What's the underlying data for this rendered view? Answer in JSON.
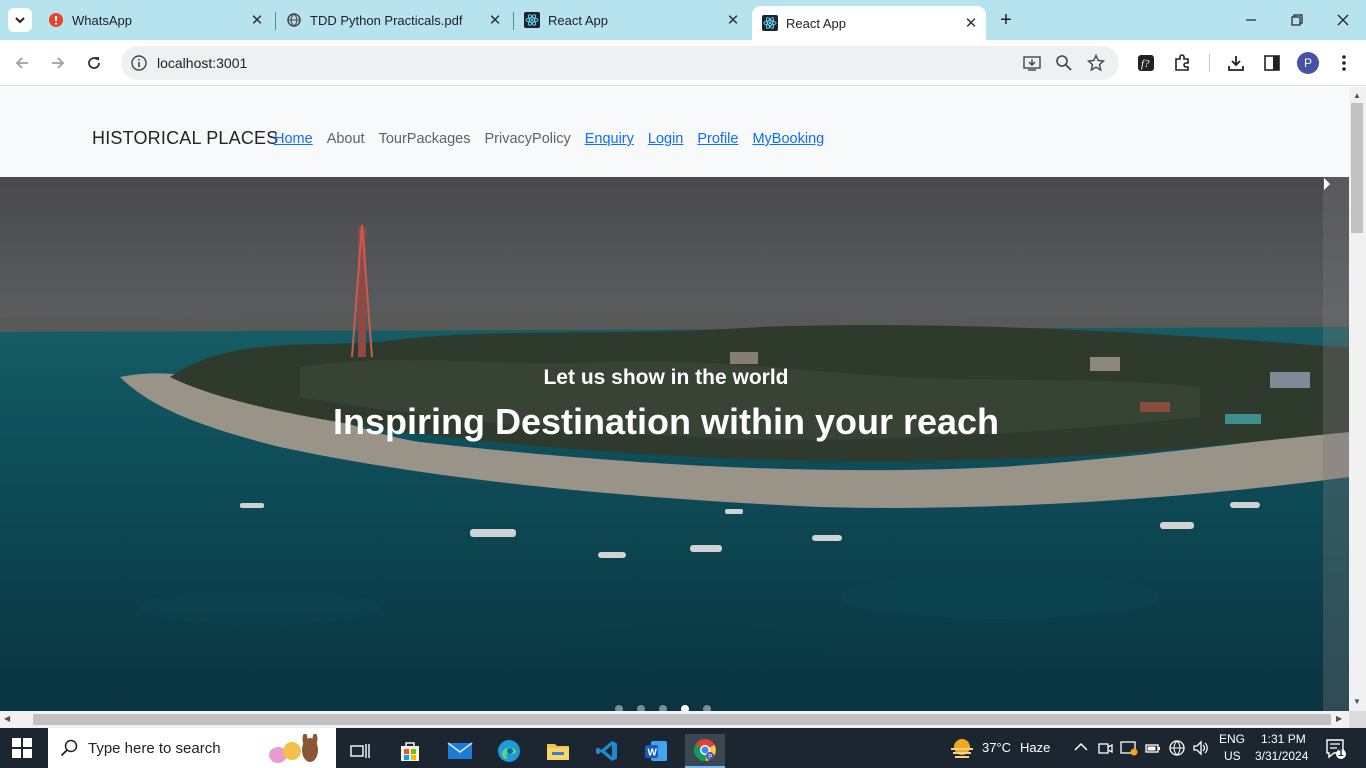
{
  "browser": {
    "tabs": [
      {
        "title": "WhatsApp",
        "icon": "whatsapp-alert-icon"
      },
      {
        "title": "TDD Python Practicals.pdf",
        "icon": "globe-icon"
      },
      {
        "title": "React App",
        "icon": "react-icon"
      },
      {
        "title": "React App",
        "icon": "react-icon",
        "active": true
      }
    ],
    "url": "localhost:3001",
    "profile_initial": "P"
  },
  "navbar": {
    "brand": "HISTORICAL PLACES",
    "links": [
      {
        "label": "Home",
        "style": "link"
      },
      {
        "label": "About",
        "style": "plain"
      },
      {
        "label": "TourPackages",
        "style": "plain"
      },
      {
        "label": "PrivacyPolicy",
        "style": "plain"
      },
      {
        "label": "Enquiry",
        "style": "link"
      },
      {
        "label": "Login",
        "style": "link"
      },
      {
        "label": "Profile",
        "style": "link"
      },
      {
        "label": "MyBooking",
        "style": "link"
      }
    ]
  },
  "hero": {
    "subtitle": "Let us show in the world",
    "title": "Inspiring Destination within your reach",
    "slide_count": 5,
    "active_slide": 4
  },
  "taskbar": {
    "search_placeholder": "Type here to search",
    "weather_temp": "37°C",
    "weather_desc": "Haze",
    "lang_top": "ENG",
    "lang_bottom": "US",
    "time": "1:31 PM",
    "date": "3/31/2024",
    "notifications": "1"
  },
  "colors": {
    "tabstrip": "#b7e3ef",
    "link": "#0d6efd",
    "taskbar": "#1c2630"
  }
}
